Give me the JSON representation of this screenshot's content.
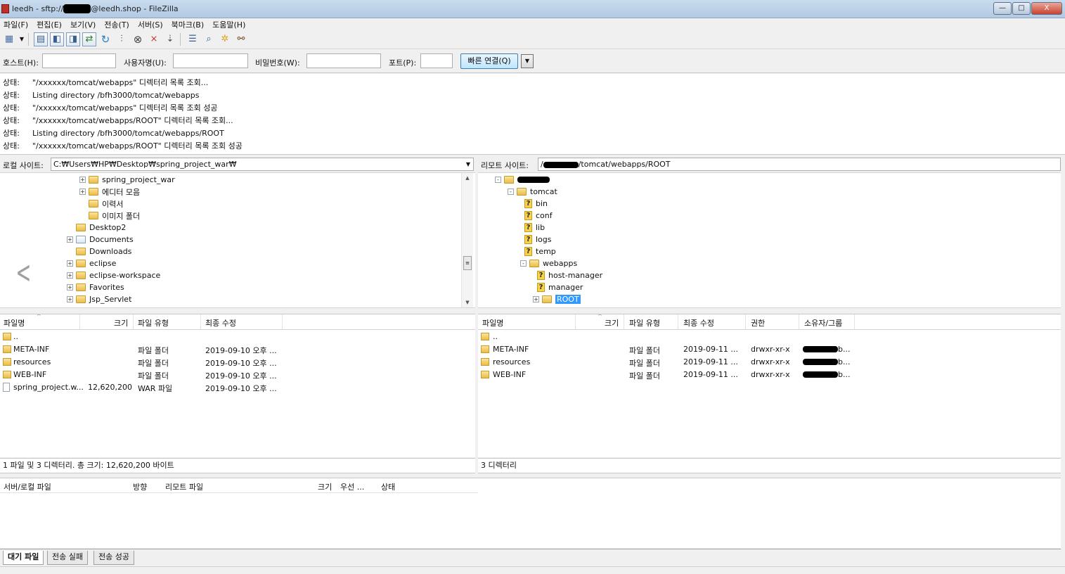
{
  "window": {
    "title_prefix": "leedh - sftp://",
    "title_redacted": "xxxxxx",
    "title_suffix": "@leedh.shop - FileZilla",
    "controls": [
      "—",
      "□",
      "X"
    ]
  },
  "menu": [
    "파일(F)",
    "편집(E)",
    "보기(V)",
    "전송(T)",
    "서버(S)",
    "북마크(B)",
    "도움말(H)"
  ],
  "quickconnect": {
    "host_label": "호스트(H):",
    "user_label": "사용자명(U):",
    "pass_label": "비밀번호(W):",
    "port_label": "포트(P):",
    "host_value": "",
    "user_value": "",
    "pass_value": "",
    "port_value": "",
    "connect_label": "빠른 연결(Q)"
  },
  "log": [
    {
      "k": "상태:",
      "m": "\"/xxxxxx/tomcat/webapps\" 디렉터리 목록 조회..."
    },
    {
      "k": "상태:",
      "m": "Listing directory /bfh3000/tomcat/webapps"
    },
    {
      "k": "상태:",
      "m": "\"/xxxxxx/tomcat/webapps\" 디렉터리 목록 조회 성공"
    },
    {
      "k": "상태:",
      "m": "\"/xxxxxx/tomcat/webapps/ROOT\" 디렉터리 목록 조회..."
    },
    {
      "k": "상태:",
      "m": "Listing directory /bfh3000/tomcat/webapps/ROOT"
    },
    {
      "k": "상태:",
      "m": "\"/xxxxxx/tomcat/webapps/ROOT\" 디렉터리 목록 조회 성공"
    }
  ],
  "local": {
    "site_label": "로컬 사이트:",
    "path": "C:₩Users₩HP₩Desktop₩spring_project_war₩",
    "tree": [
      {
        "label": "spring_project_war",
        "exp": "+",
        "icon": "folder"
      },
      {
        "label": "에디터 모음",
        "exp": "+",
        "icon": "folder"
      },
      {
        "label": "이력서",
        "exp": "",
        "icon": "folder"
      },
      {
        "label": "이미지 폴더",
        "exp": "",
        "icon": "folder"
      },
      {
        "label": "Desktop2",
        "exp": "",
        "icon": "folder"
      },
      {
        "label": "Documents",
        "exp": "+",
        "icon": "doc"
      },
      {
        "label": "Downloads",
        "exp": "",
        "icon": "folder"
      },
      {
        "label": "eclipse",
        "exp": "+",
        "icon": "folder"
      },
      {
        "label": "eclipse-workspace",
        "exp": "+",
        "icon": "folder"
      },
      {
        "label": "Favorites",
        "exp": "+",
        "icon": "fav"
      },
      {
        "label": "Jsp_Servlet",
        "exp": "+",
        "icon": "folder"
      }
    ],
    "columns": [
      "파일명",
      "크기",
      "파일 유형",
      "최종 수정"
    ],
    "files": [
      {
        "name": "..",
        "size": "",
        "type": "",
        "modified": "",
        "icon": "folder"
      },
      {
        "name": "META-INF",
        "size": "",
        "type": "파일 폴더",
        "modified": "2019-09-10 오후 ...",
        "icon": "folder"
      },
      {
        "name": "resources",
        "size": "",
        "type": "파일 폴더",
        "modified": "2019-09-10 오후 ...",
        "icon": "folder"
      },
      {
        "name": "WEB-INF",
        "size": "",
        "type": "파일 폴더",
        "modified": "2019-09-10 오후 ...",
        "icon": "folder"
      },
      {
        "name": "spring_project.w...",
        "size": "12,620,200",
        "type": "WAR 파일",
        "modified": "2019-09-10 오후 ...",
        "icon": "file"
      }
    ],
    "status": "1 파일 및 3 디렉터리. 총 크기: 12,620,200 바이트"
  },
  "remote": {
    "site_label": "리모트 사이트:",
    "path_prefix": "/",
    "path_suffix": "/tomcat/webapps/ROOT",
    "tree": [
      {
        "label": "",
        "exp": "-",
        "icon": "folder",
        "indent": 0,
        "redacted": true
      },
      {
        "label": "tomcat",
        "exp": "-",
        "icon": "folder",
        "indent": 1
      },
      {
        "label": "bin",
        "exp": "",
        "icon": "q",
        "indent": 2
      },
      {
        "label": "conf",
        "exp": "",
        "icon": "q",
        "indent": 2
      },
      {
        "label": "lib",
        "exp": "",
        "icon": "q",
        "indent": 2
      },
      {
        "label": "logs",
        "exp": "",
        "icon": "q",
        "indent": 2
      },
      {
        "label": "temp",
        "exp": "",
        "icon": "q",
        "indent": 2
      },
      {
        "label": "webapps",
        "exp": "-",
        "icon": "folder",
        "indent": 2
      },
      {
        "label": "host-manager",
        "exp": "",
        "icon": "q",
        "indent": 3
      },
      {
        "label": "manager",
        "exp": "",
        "icon": "q",
        "indent": 3
      },
      {
        "label": "ROOT",
        "exp": "+",
        "icon": "folder",
        "indent": 3,
        "selected": true
      }
    ],
    "columns": [
      "파일명",
      "크기",
      "파일 유형",
      "최종 수정",
      "권한",
      "소유자/그룹"
    ],
    "files": [
      {
        "name": "..",
        "size": "",
        "type": "",
        "modified": "",
        "perm": "",
        "owner": ""
      },
      {
        "name": "META-INF",
        "size": "",
        "type": "파일 폴더",
        "modified": "2019-09-11 ...",
        "perm": "drwxr-xr-x",
        "owner": "b..."
      },
      {
        "name": "resources",
        "size": "",
        "type": "파일 폴더",
        "modified": "2019-09-11 ...",
        "perm": "drwxr-xr-x",
        "owner": "b..."
      },
      {
        "name": "WEB-INF",
        "size": "",
        "type": "파일 폴더",
        "modified": "2019-09-11 ...",
        "perm": "drwxr-xr-x",
        "owner": "b..."
      }
    ],
    "status": "3 디렉터리"
  },
  "queue": {
    "columns": [
      "서버/로컬 파일",
      "방향",
      "리모트 파일",
      "크기",
      "우선 ...",
      "상태"
    ],
    "tabs": [
      "대기 파일",
      "전송 실패",
      "전송 성공"
    ]
  }
}
